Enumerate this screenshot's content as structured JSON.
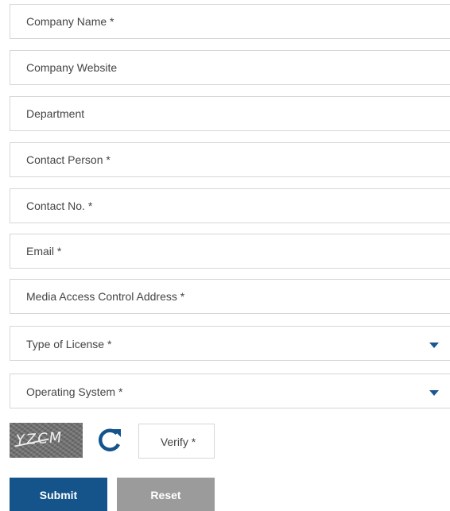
{
  "form": {
    "fields": [
      {
        "placeholder": "Company Name *",
        "value": ""
      },
      {
        "placeholder": "Company Website",
        "value": ""
      },
      {
        "placeholder": "Department",
        "value": ""
      },
      {
        "placeholder": "Contact Person *",
        "value": ""
      },
      {
        "placeholder": "Contact No. *",
        "value": ""
      },
      {
        "placeholder": "Email *",
        "value": ""
      },
      {
        "placeholder": "Media Access Control Address *",
        "value": ""
      }
    ],
    "selects": [
      {
        "label": "Type of License *",
        "icon": "chevron-down-icon"
      },
      {
        "label": "Operating System *",
        "icon": "chevron-down-icon"
      }
    ],
    "captcha": {
      "text": "YZCM",
      "refresh_icon": "refresh-icon",
      "verify_placeholder": "Verify *"
    },
    "buttons": {
      "submit_label": "Submit",
      "reset_label": "Reset"
    }
  },
  "colors": {
    "accent": "#14548b",
    "reset": "#9b9b9b",
    "border": "#d6d6d6"
  }
}
